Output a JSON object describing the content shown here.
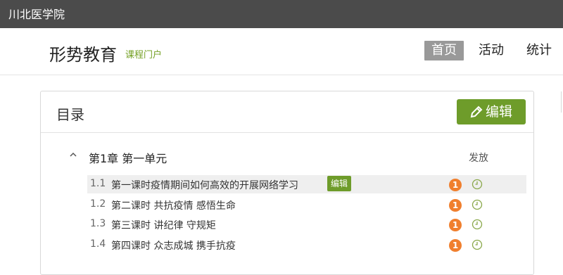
{
  "topbar": {
    "school": "川北医学院"
  },
  "header": {
    "title": "形势教育",
    "subtitle": "课程门户",
    "nav": {
      "home": "首页",
      "activity": "活动",
      "stats": "统计"
    }
  },
  "catalog": {
    "title": "目录",
    "edit_label": "编辑",
    "chapter": {
      "title": "第1章 第一单元",
      "publish_label": "发放"
    },
    "lessons": [
      {
        "num": "1.1",
        "title": "第一课时疫情期间如何高效的开展网络学习",
        "edit": "编辑",
        "badge": "1"
      },
      {
        "num": "1.2",
        "title": "第二课时 共抗疫情 感悟生命",
        "badge": "1"
      },
      {
        "num": "1.3",
        "title": "第三课时 讲纪律 守规矩",
        "badge": "1"
      },
      {
        "num": "1.4",
        "title": "第四课时 众志成城 携手抗疫",
        "badge": "1"
      }
    ]
  },
  "colors": {
    "accent": "#6e9c2a",
    "badge": "#f07f2e",
    "topbar": "#4b4b4b"
  }
}
